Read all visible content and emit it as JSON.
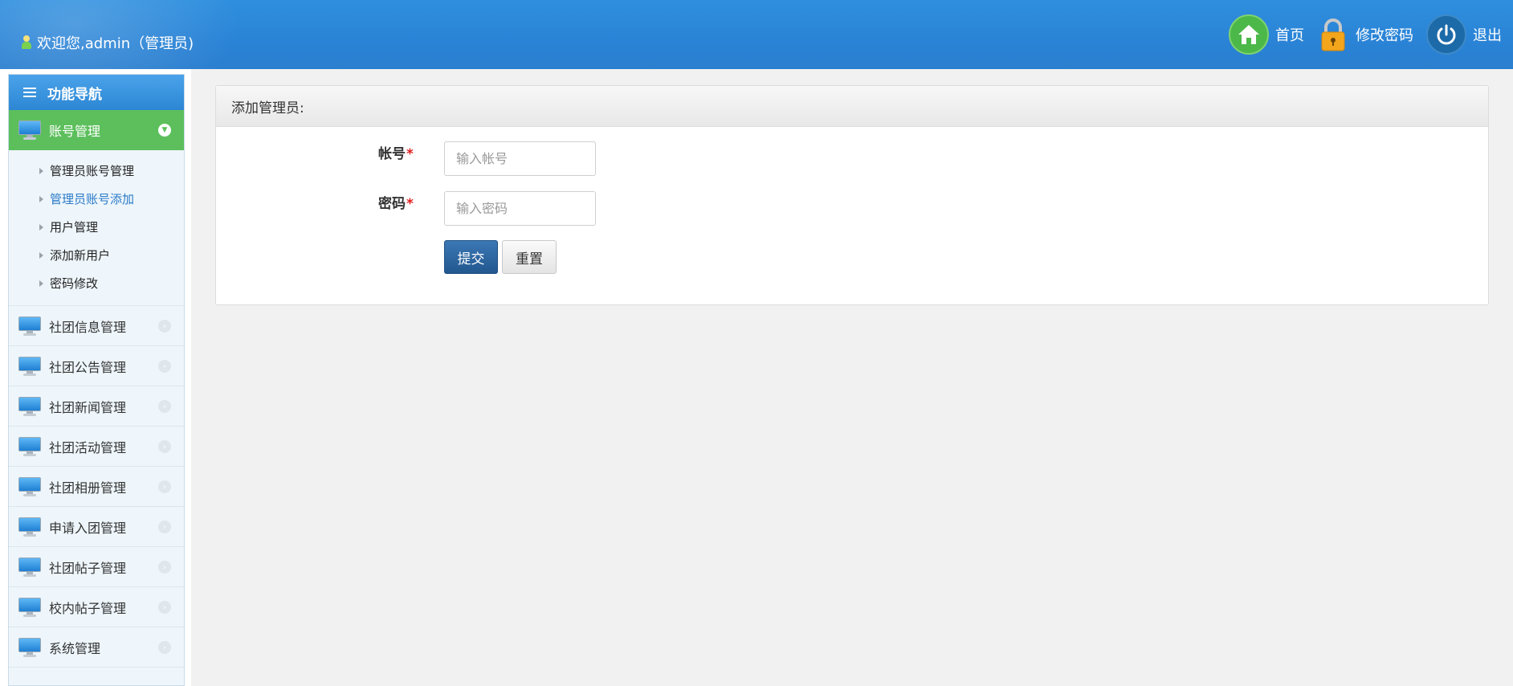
{
  "header": {
    "welcome": "欢迎您,admin（管理员)",
    "actions": [
      {
        "label": "首页",
        "icon": "home-icon"
      },
      {
        "label": "修改密码",
        "icon": "lock-icon"
      },
      {
        "label": "退出",
        "icon": "power-icon"
      }
    ]
  },
  "sidebar": {
    "title": "功能导航",
    "active_group": {
      "label": "账号管理",
      "items": [
        {
          "label": "管理员账号管理",
          "current": false
        },
        {
          "label": "管理员账号添加",
          "current": true
        },
        {
          "label": "用户管理",
          "current": false
        },
        {
          "label": "添加新用户",
          "current": false
        },
        {
          "label": "密码修改",
          "current": false
        }
      ]
    },
    "groups": [
      {
        "label": "社团信息管理"
      },
      {
        "label": "社团公告管理"
      },
      {
        "label": "社团新闻管理"
      },
      {
        "label": "社团活动管理"
      },
      {
        "label": "社团相册管理"
      },
      {
        "label": "申请入团管理"
      },
      {
        "label": "社团帖子管理"
      },
      {
        "label": "校内帖子管理"
      },
      {
        "label": "系统管理"
      }
    ]
  },
  "panel": {
    "title": "添加管理员:",
    "account_label": "帐号",
    "account_placeholder": "输入帐号",
    "account_value": "",
    "password_label": "密码",
    "password_placeholder": "输入密码",
    "password_value": "",
    "required_mark": "*",
    "submit_label": "提交",
    "reset_label": "重置"
  },
  "colors": {
    "header_blue": "#2b84d5",
    "active_green": "#5cbf5c",
    "primary_button": "#2d68a3",
    "required_red": "#e02020"
  }
}
